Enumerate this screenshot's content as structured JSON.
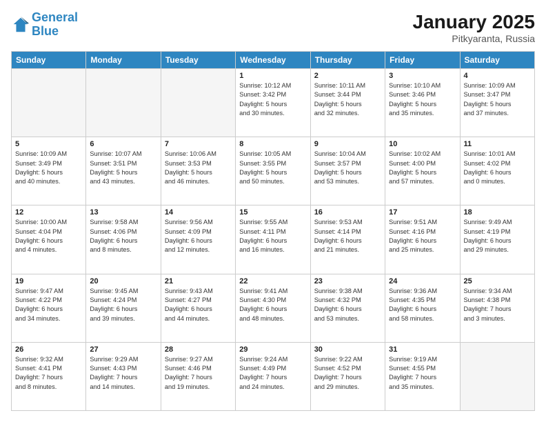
{
  "header": {
    "logo_line1": "General",
    "logo_line2": "Blue",
    "month": "January 2025",
    "location": "Pitkyaranta, Russia"
  },
  "weekdays": [
    "Sunday",
    "Monday",
    "Tuesday",
    "Wednesday",
    "Thursday",
    "Friday",
    "Saturday"
  ],
  "weeks": [
    [
      {
        "day": "",
        "info": ""
      },
      {
        "day": "",
        "info": ""
      },
      {
        "day": "",
        "info": ""
      },
      {
        "day": "1",
        "info": "Sunrise: 10:12 AM\nSunset: 3:42 PM\nDaylight: 5 hours\nand 30 minutes."
      },
      {
        "day": "2",
        "info": "Sunrise: 10:11 AM\nSunset: 3:44 PM\nDaylight: 5 hours\nand 32 minutes."
      },
      {
        "day": "3",
        "info": "Sunrise: 10:10 AM\nSunset: 3:46 PM\nDaylight: 5 hours\nand 35 minutes."
      },
      {
        "day": "4",
        "info": "Sunrise: 10:09 AM\nSunset: 3:47 PM\nDaylight: 5 hours\nand 37 minutes."
      }
    ],
    [
      {
        "day": "5",
        "info": "Sunrise: 10:09 AM\nSunset: 3:49 PM\nDaylight: 5 hours\nand 40 minutes."
      },
      {
        "day": "6",
        "info": "Sunrise: 10:07 AM\nSunset: 3:51 PM\nDaylight: 5 hours\nand 43 minutes."
      },
      {
        "day": "7",
        "info": "Sunrise: 10:06 AM\nSunset: 3:53 PM\nDaylight: 5 hours\nand 46 minutes."
      },
      {
        "day": "8",
        "info": "Sunrise: 10:05 AM\nSunset: 3:55 PM\nDaylight: 5 hours\nand 50 minutes."
      },
      {
        "day": "9",
        "info": "Sunrise: 10:04 AM\nSunset: 3:57 PM\nDaylight: 5 hours\nand 53 minutes."
      },
      {
        "day": "10",
        "info": "Sunrise: 10:02 AM\nSunset: 4:00 PM\nDaylight: 5 hours\nand 57 minutes."
      },
      {
        "day": "11",
        "info": "Sunrise: 10:01 AM\nSunset: 4:02 PM\nDaylight: 6 hours\nand 0 minutes."
      }
    ],
    [
      {
        "day": "12",
        "info": "Sunrise: 10:00 AM\nSunset: 4:04 PM\nDaylight: 6 hours\nand 4 minutes."
      },
      {
        "day": "13",
        "info": "Sunrise: 9:58 AM\nSunset: 4:06 PM\nDaylight: 6 hours\nand 8 minutes."
      },
      {
        "day": "14",
        "info": "Sunrise: 9:56 AM\nSunset: 4:09 PM\nDaylight: 6 hours\nand 12 minutes."
      },
      {
        "day": "15",
        "info": "Sunrise: 9:55 AM\nSunset: 4:11 PM\nDaylight: 6 hours\nand 16 minutes."
      },
      {
        "day": "16",
        "info": "Sunrise: 9:53 AM\nSunset: 4:14 PM\nDaylight: 6 hours\nand 21 minutes."
      },
      {
        "day": "17",
        "info": "Sunrise: 9:51 AM\nSunset: 4:16 PM\nDaylight: 6 hours\nand 25 minutes."
      },
      {
        "day": "18",
        "info": "Sunrise: 9:49 AM\nSunset: 4:19 PM\nDaylight: 6 hours\nand 29 minutes."
      }
    ],
    [
      {
        "day": "19",
        "info": "Sunrise: 9:47 AM\nSunset: 4:22 PM\nDaylight: 6 hours\nand 34 minutes."
      },
      {
        "day": "20",
        "info": "Sunrise: 9:45 AM\nSunset: 4:24 PM\nDaylight: 6 hours\nand 39 minutes."
      },
      {
        "day": "21",
        "info": "Sunrise: 9:43 AM\nSunset: 4:27 PM\nDaylight: 6 hours\nand 44 minutes."
      },
      {
        "day": "22",
        "info": "Sunrise: 9:41 AM\nSunset: 4:30 PM\nDaylight: 6 hours\nand 48 minutes."
      },
      {
        "day": "23",
        "info": "Sunrise: 9:38 AM\nSunset: 4:32 PM\nDaylight: 6 hours\nand 53 minutes."
      },
      {
        "day": "24",
        "info": "Sunrise: 9:36 AM\nSunset: 4:35 PM\nDaylight: 6 hours\nand 58 minutes."
      },
      {
        "day": "25",
        "info": "Sunrise: 9:34 AM\nSunset: 4:38 PM\nDaylight: 7 hours\nand 3 minutes."
      }
    ],
    [
      {
        "day": "26",
        "info": "Sunrise: 9:32 AM\nSunset: 4:41 PM\nDaylight: 7 hours\nand 8 minutes."
      },
      {
        "day": "27",
        "info": "Sunrise: 9:29 AM\nSunset: 4:43 PM\nDaylight: 7 hours\nand 14 minutes."
      },
      {
        "day": "28",
        "info": "Sunrise: 9:27 AM\nSunset: 4:46 PM\nDaylight: 7 hours\nand 19 minutes."
      },
      {
        "day": "29",
        "info": "Sunrise: 9:24 AM\nSunset: 4:49 PM\nDaylight: 7 hours\nand 24 minutes."
      },
      {
        "day": "30",
        "info": "Sunrise: 9:22 AM\nSunset: 4:52 PM\nDaylight: 7 hours\nand 29 minutes."
      },
      {
        "day": "31",
        "info": "Sunrise: 9:19 AM\nSunset: 4:55 PM\nDaylight: 7 hours\nand 35 minutes."
      },
      {
        "day": "",
        "info": ""
      }
    ]
  ]
}
